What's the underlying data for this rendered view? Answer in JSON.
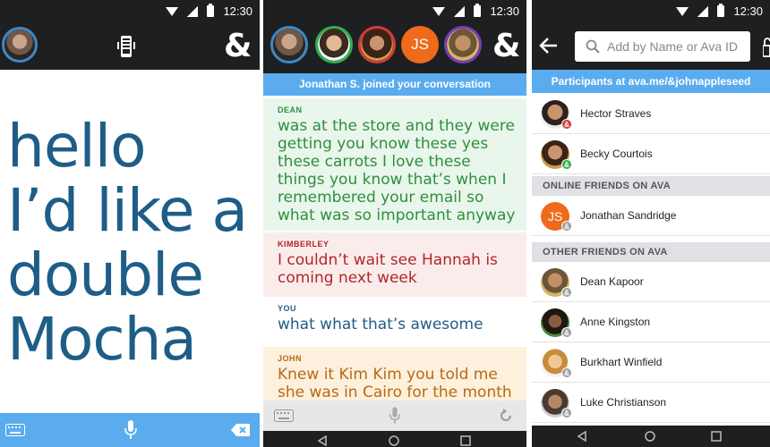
{
  "status": {
    "time": "12:30"
  },
  "screen1": {
    "transcript_lines": [
      "hello",
      "I’d like a",
      "double",
      "Mocha"
    ],
    "amp_logo": "&"
  },
  "screen2": {
    "amp_logo": "&",
    "avatars": [
      {
        "kind": "photo",
        "ring": "#3f89c8"
      },
      {
        "kind": "photo",
        "ring": "#2fb24a"
      },
      {
        "kind": "photo",
        "ring": "#d63939"
      },
      {
        "kind": "initials",
        "initials": "JS",
        "bg": "#ef6a1b"
      },
      {
        "kind": "photo",
        "ring": "#7a3db8"
      }
    ],
    "join_banner": "Jonathan S. joined your conversation",
    "messages": [
      {
        "speaker": "DEAN",
        "text": "was at the store and they were getting you know these yes these carrots I love these things you know that’s when I remembered your email so what was so important anyway",
        "color": "#2e8f3e",
        "bg": "#e9f6ec"
      },
      {
        "speaker": "KIMBERLEY",
        "text": "I couldn’t wait see Hannah is coming next week",
        "color": "#b0262b",
        "bg": "#fbecec"
      },
      {
        "speaker": "YOU",
        "text": "what what that’s awesome",
        "color": "#1e5d87",
        "bg": "#ffffff"
      },
      {
        "speaker": "JOHN",
        "text": "Knew it Kim Kim you told me she was in Cairo for the month",
        "color": "#b86a12",
        "bg": "#fdf0dc"
      }
    ]
  },
  "screen3": {
    "search_placeholder": "Add by Name or Ava ID",
    "participants_banner": "Participants at ava.me/&johnappleseed",
    "participants": [
      {
        "name": "Hector Straves",
        "badge_color": "#d63939",
        "avatar_color": "#8a5a3c"
      },
      {
        "name": "Becky Courtois",
        "badge_color": "#2fb24a",
        "avatar_color": "#b8862f"
      }
    ],
    "online_header": "ONLINE FRIENDS ON AVA",
    "online": [
      {
        "name": "Jonathan Sandridge",
        "initials": "JS",
        "avatar_color": "#ef6a1b",
        "badge_color": "#9e9e9e"
      }
    ],
    "other_header": "OTHER FRIENDS ON AVA",
    "other": [
      {
        "name": "Dean Kapoor",
        "avatar_color": "#a97a4f",
        "badge_color": "#9e9e9e"
      },
      {
        "name": "Anne Kingston",
        "avatar_color": "#3d2f28",
        "badge_color": "#9e9e9e"
      },
      {
        "name": "Burkhart Winfield",
        "avatar_color": "#d89a3e",
        "badge_color": "#9e9e9e"
      },
      {
        "name": "Luke Christianson",
        "avatar_color": "#5b4b3f",
        "badge_color": "#9e9e9e"
      }
    ]
  }
}
